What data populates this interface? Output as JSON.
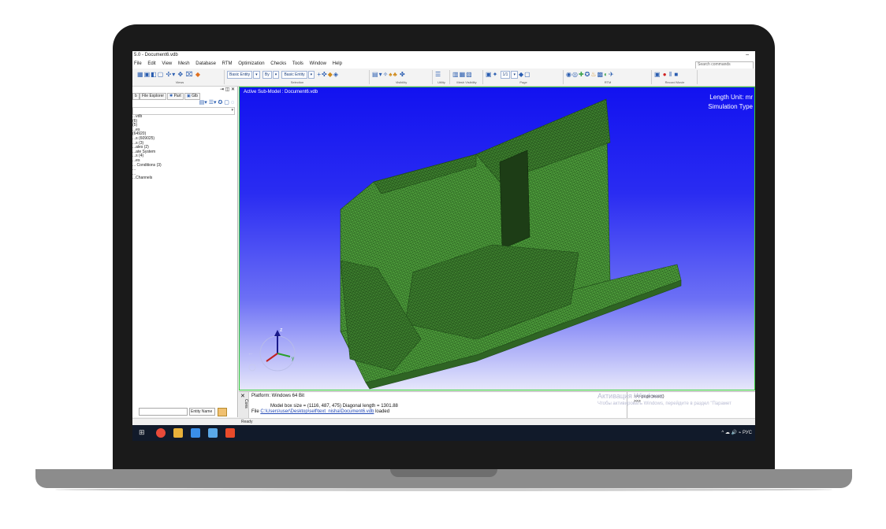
{
  "window": {
    "title": "5.0 - Document6.vdb",
    "minimize_label": "–"
  },
  "menu": [
    "File",
    "Edit",
    "View",
    "Mesh",
    "Database",
    "RTM",
    "Optimization",
    "Checks",
    "Tools",
    "Window",
    "Help"
  ],
  "search": {
    "placeholder": "Search commands"
  },
  "toolbar": {
    "selectors": [
      "Basic Entity",
      "By",
      "Basic Entity"
    ],
    "page_value": "1/1",
    "group_labels": [
      "Views",
      "Selection",
      "Visibility",
      "Utility",
      "Mesh Visibility",
      "Page",
      "RTM",
      "Record Movie"
    ]
  },
  "side_panel": {
    "tabs": [
      "File Explorer",
      "Part",
      "Glb"
    ],
    "tree_items": [
      "...vdb",
      "(6)",
      "(5)",
      "...es",
      "(64920)",
      "...s (609025)",
      "...s (3)",
      "...ales (2)",
      "...ate System",
      "...s (4)",
      "...es",
      "... Conditions (3)",
      "...",
      "...",
      "...Channels"
    ],
    "filter_label": "Entity Name"
  },
  "viewport": {
    "title": "Active Sub-Model : Document6.vdb",
    "length_unit": "Length Unit: mr",
    "simulation_type": "Simulation Type",
    "axes": {
      "z": "z",
      "y": "y"
    },
    "mesh_color": "#4c9a3a",
    "mesh_line_color": "#1f4a18",
    "bg_top": "#1212f0",
    "bg_bottom": "#e6e7fb",
    "border_color": "#36d13a"
  },
  "console": {
    "platform": "Platform: Windows 64 Bit",
    "model_box": "Model box size          = (1116, 487, 475)  Diagonal length = 1301.88",
    "file_prefix": "File ",
    "file_path": "C:\\Users\\user\\Desktop\\self\\text_nisha\\Document6.vdb",
    "file_suffix": " loaded",
    "side_label": "Cons"
  },
  "command": {
    "line1": ">>> pagecreate()",
    "line2": ">>>"
  },
  "watermark": {
    "line1": "Активация Windows",
    "line2": "Чтобы активировать Windows, перейдите в раздел \"Парамет"
  },
  "status": {
    "text": "Ready"
  },
  "taskbar": {
    "tray_text": "^ ☁ 🔊 ⌁ РУС"
  }
}
